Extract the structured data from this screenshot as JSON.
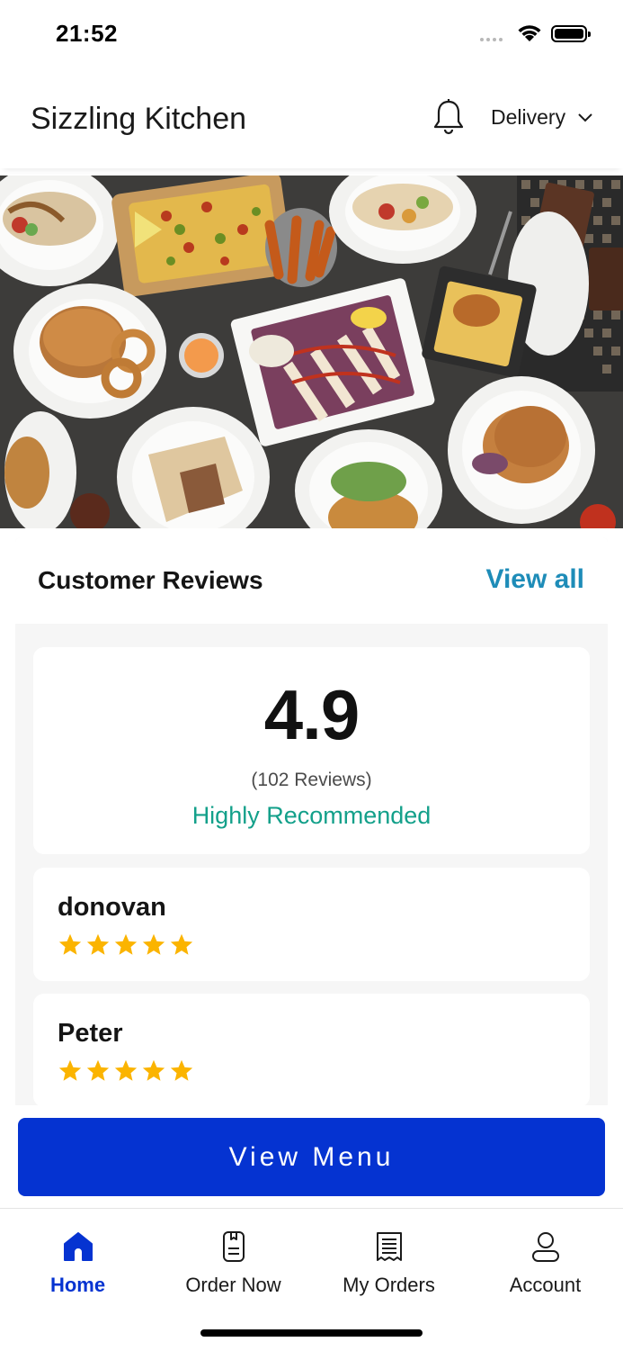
{
  "status_bar": {
    "time": "21:52"
  },
  "header": {
    "title": "Sizzling Kitchen",
    "delivery_label": "Delivery"
  },
  "hero": {
    "image": "food-platters-photo"
  },
  "reviews": {
    "title": "Customer Reviews",
    "view_all": "View all",
    "rating": "4.9",
    "count": "(102 Reviews)",
    "recommendation": "Highly Recommended",
    "items": [
      {
        "name": "donovan",
        "stars": 5
      },
      {
        "name": "Peter",
        "stars": 5
      }
    ]
  },
  "cta": {
    "label": "View Menu"
  },
  "tabs": [
    {
      "label": "Home",
      "icon": "home-icon",
      "active": true
    },
    {
      "label": "Order Now",
      "icon": "order-icon",
      "active": false
    },
    {
      "label": "My Orders",
      "icon": "receipt-icon",
      "active": false
    },
    {
      "label": "Account",
      "icon": "account-icon",
      "active": false
    }
  ],
  "colors": {
    "primary": "#0533d1",
    "link": "#1e8cb8",
    "recommend": "#13a08a",
    "star": "#fbb400"
  }
}
